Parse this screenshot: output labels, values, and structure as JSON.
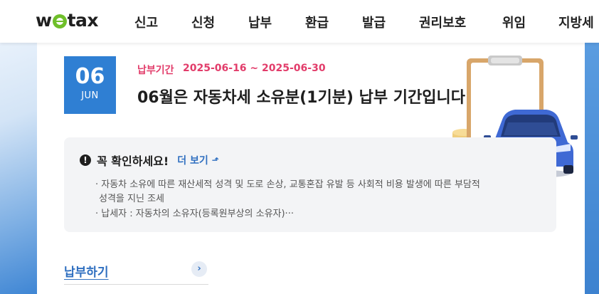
{
  "logo": {
    "text_before": "w",
    "text_after": "tax"
  },
  "nav": {
    "items": [
      {
        "label": "신고"
      },
      {
        "label": "신청"
      },
      {
        "label": "납부"
      },
      {
        "label": "환급"
      },
      {
        "label": "발급"
      },
      {
        "label": "권리보호"
      },
      {
        "label": "위임"
      },
      {
        "label": "지방세"
      }
    ]
  },
  "schedule": {
    "day": "06",
    "month": "JUN",
    "period_label": "납부기간",
    "period_range": "2025-06-16 ~ 2025-06-30",
    "headline": "06월은 자동차세 소유분(1기분) 납부 기간입니다"
  },
  "notice": {
    "icon": "!",
    "title": "꼭 확인하세요!",
    "more_label": "더 보기",
    "lines": [
      "· 자동차 소유에 따른 재산세적 성격 및 도로 손상, 교통혼잡 유발 등 사회적 비용 발생에 따른 부담적",
      "성격을 지닌 조세",
      "· 납세자 : 자동차의 소유자(등록원부상의 소유자)···"
    ]
  },
  "action": {
    "pay_label": "납부하기",
    "pay_arrow": "›"
  },
  "colors": {
    "accent": "#2f7fd3",
    "period": "#e23c6a",
    "link": "#2f6fc0",
    "logo_mark": "#6fbf2a"
  }
}
